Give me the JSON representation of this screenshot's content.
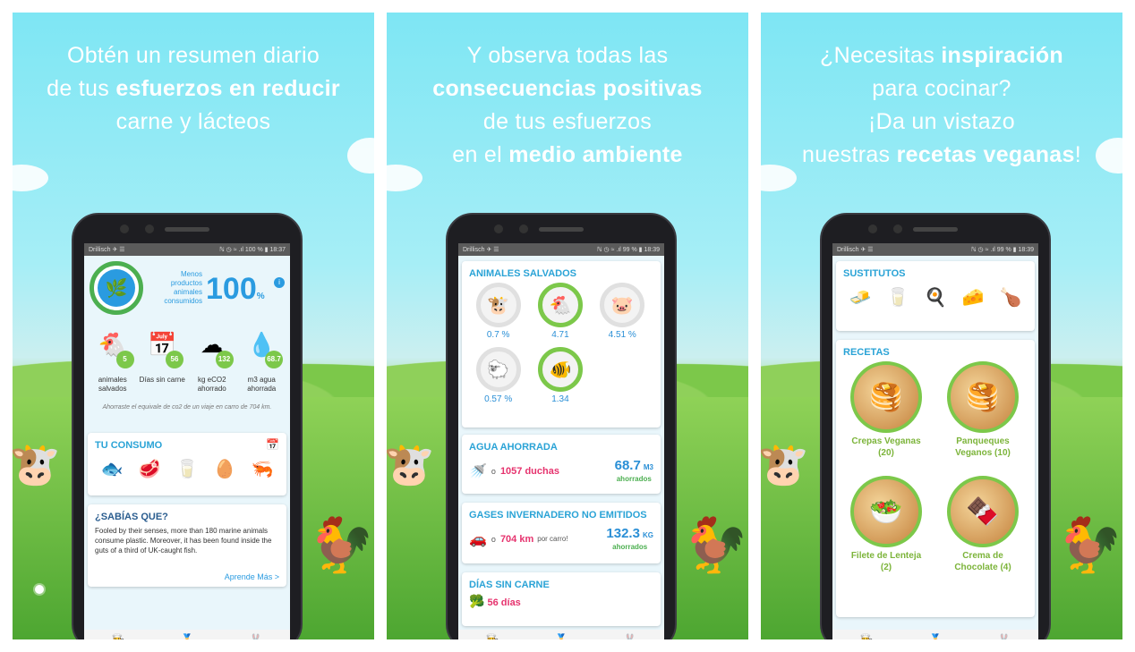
{
  "panels": [
    {
      "headline_html": "Obtén un resumen diario<br>de tus <b>esfuerzos en reducir</b><br>carne y lácteos",
      "status": {
        "carrier": "Drillisch ✈ ☰",
        "right": "ℕ ◷ ≈ .ıl 100 % ▮ 18:37"
      }
    },
    {
      "headline_html": "Y observa todas las<br><b>consecuencias positivas</b><br>de tus esfuerzos<br>en el <b>medio ambiente</b>",
      "status": {
        "carrier": "Drillisch ✈ ☰",
        "right": "ℕ ◷ ≈ .ıl 99 % ▮ 18:39"
      }
    },
    {
      "headline_html": "¿Necesitas <b>inspiración</b><br>para cocinar?<br>¡Da un vistazo<br>nuestras <b>recetas veganas</b>!",
      "status": {
        "carrier": "Drillisch ✈ ☰",
        "right": "ℕ ◷ ≈ .ıl 99 % ▮ 18:39"
      }
    }
  ],
  "summary": {
    "ring_label": "Menos productos animales consumidos",
    "percent": "100",
    "percent_unit": "%",
    "stats": [
      {
        "icon": "chicken-icon",
        "glyph": "🐔",
        "value": "5",
        "label": "animales salvados"
      },
      {
        "icon": "calendar-icon",
        "glyph": "📅",
        "value": "56",
        "label": "Días sin carne"
      },
      {
        "icon": "cloud-co2-icon",
        "glyph": "☁",
        "value": "132",
        "label": "kg eCO2 ahorrado"
      },
      {
        "icon": "water-drop-icon",
        "glyph": "💧",
        "value": "68.7",
        "label": "m3 agua ahorrada"
      }
    ],
    "quote": "Ahorraste el equivale de co2 de un viaje en carro de 704 km.",
    "consumo_title": "TU CONSUMO",
    "consumo_icons": [
      {
        "name": "fish-icon",
        "glyph": "🐟"
      },
      {
        "name": "meat-icon",
        "glyph": "🥩"
      },
      {
        "name": "milk-icon",
        "glyph": "🥛"
      },
      {
        "name": "egg-icon",
        "glyph": "🥚"
      },
      {
        "name": "seafood-icon",
        "glyph": "🦐"
      }
    ],
    "fact_title": "¿SABÍAS QUE?",
    "fact_text": "Fooled by their senses, more than 180 marine animals consume plastic. Moreover, it has been found inside the guts of a third of UK-caught fish.",
    "fact_link": "Aprende Más >"
  },
  "impact": {
    "animals_title": "ANIMALES SALVADOS",
    "animals": [
      {
        "icon": "cow-icon",
        "glyph": "🐮",
        "value": "0.7 %"
      },
      {
        "icon": "chicken-icon",
        "glyph": "🐔",
        "value": "4.71"
      },
      {
        "icon": "pig-icon",
        "glyph": "🐷",
        "value": "4.51 %"
      },
      {
        "icon": "sheep-icon",
        "glyph": "🐑",
        "value": "0.57 %"
      },
      {
        "icon": "fish-icon",
        "glyph": "🐠",
        "value": "1.34"
      }
    ],
    "water_title": "AGUA AHORRADA",
    "water_prefix": "o",
    "water_equiv": "1057 duchas",
    "water_value": "68.7",
    "water_unit": "M3",
    "water_saved": "ahorrados",
    "gas_title": "GASES INVERNADERO NO EMITIDOS",
    "gas_prefix": "o",
    "gas_equiv": "704 km",
    "gas_equiv_suffix": "por carro!",
    "gas_value": "132.3",
    "gas_unit": "KG",
    "gas_saved": "ahorrados",
    "days_title": "DÍAS SIN CARNE",
    "days_value": "56 días"
  },
  "recipes": {
    "subs_title": "SUSTITUTOS",
    "subs": [
      {
        "name": "butter-icon",
        "glyph": "🧈"
      },
      {
        "name": "milk-icon",
        "glyph": "🥛"
      },
      {
        "name": "egg-icon",
        "glyph": "🍳"
      },
      {
        "name": "cheese-icon",
        "glyph": "🧀"
      },
      {
        "name": "drumstick-icon",
        "glyph": "🍗"
      }
    ],
    "recipes_title": "RECETAS",
    "items": [
      {
        "label": "Crepas Veganas (20)",
        "glyph": "🥞"
      },
      {
        "label": "Panqueques Veganos (10)",
        "glyph": "🥞"
      },
      {
        "label": "Filete de Lenteja (2)",
        "glyph": "🥗"
      },
      {
        "label": "Crema de Chocolate (4)",
        "glyph": "🍫"
      }
    ]
  },
  "nav": {
    "icons": [
      "chef-hat-icon",
      "medal-icon",
      "rabbit-icon"
    ],
    "glyphs": [
      "👨‍🍳",
      "🏅",
      "🐰"
    ]
  }
}
